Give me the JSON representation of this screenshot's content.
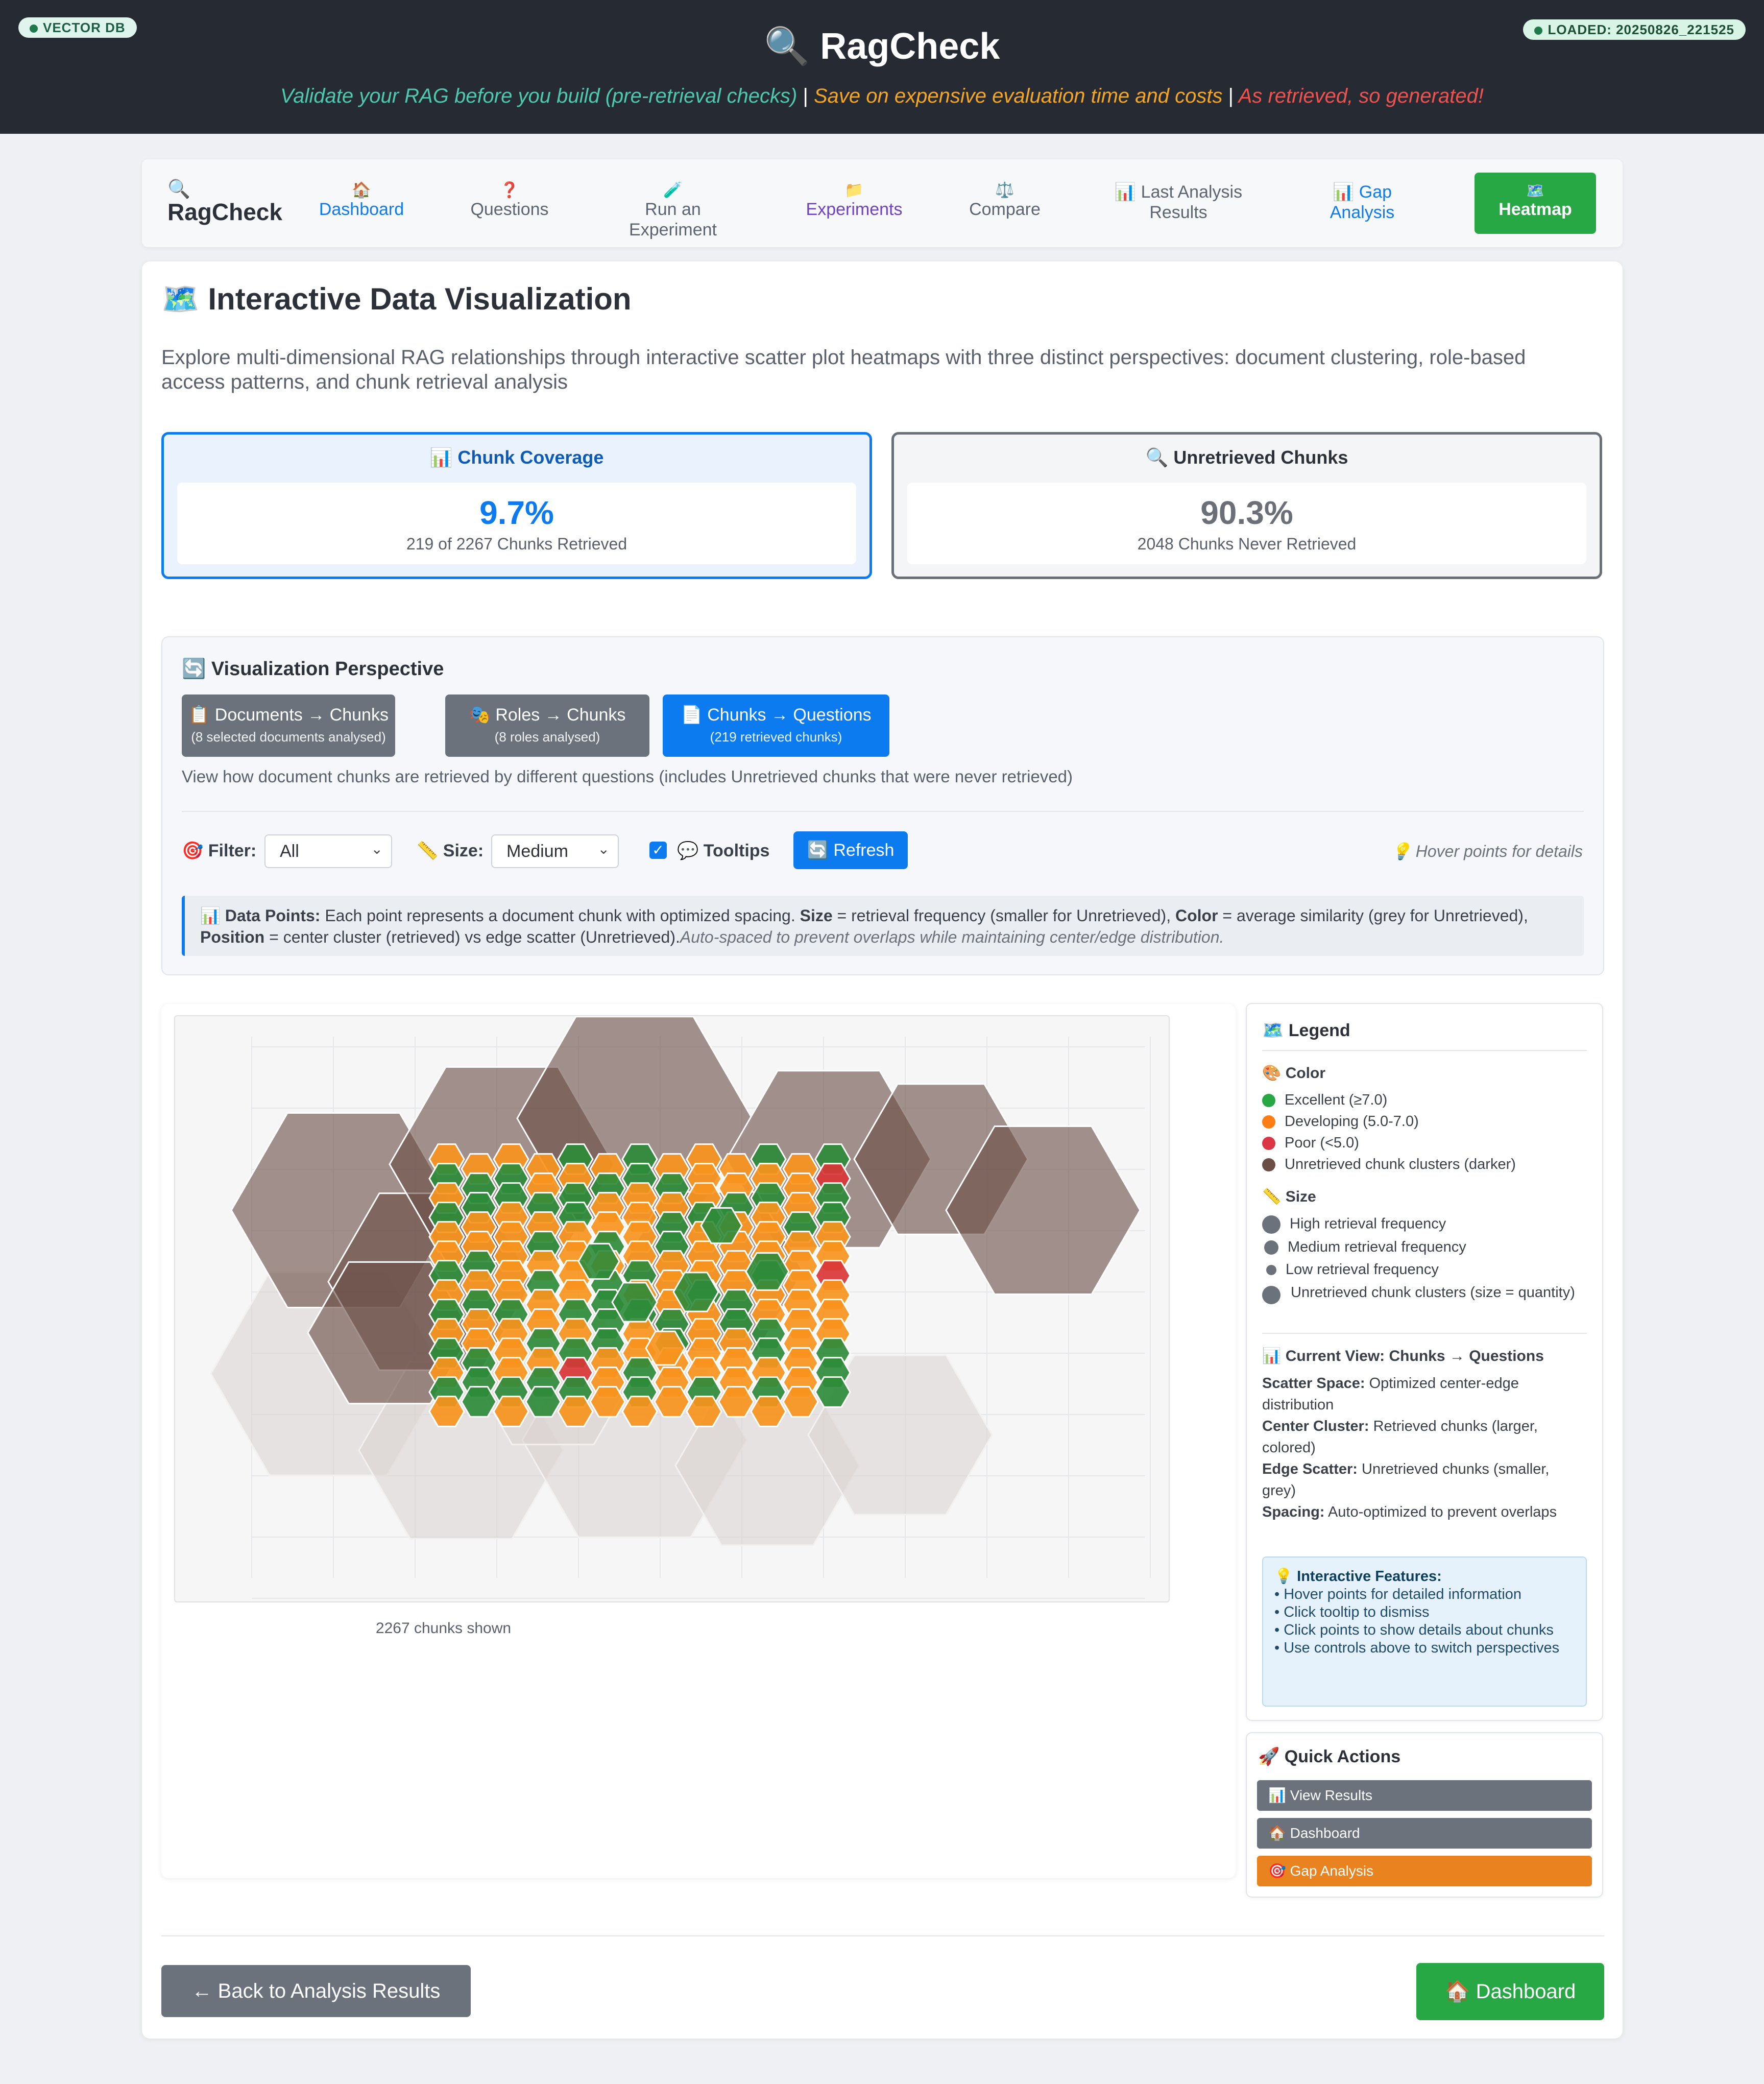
{
  "header": {
    "badge_left": "VECTOR DB",
    "badge_right": "LOADED: 20250826_221525",
    "title": "🔍 RagCheck",
    "tagline": {
      "part1": "Validate your RAG before you build (pre-retrieval checks)",
      "part2": "Save on expensive evaluation time and costs",
      "part3": "As retrieved, so generated!",
      "separator": "|",
      "colors": {
        "part1": "#4ec9b0",
        "part2": "#f5a623",
        "part3": "#ef5350"
      }
    }
  },
  "nav": {
    "brand_icon": "🔍",
    "brand": "RagCheck",
    "items": [
      {
        "icon": "🏠",
        "line1": "Dashboard",
        "line2": "",
        "color": "#0d7bf0"
      },
      {
        "icon": "❓",
        "line1": "Questions",
        "line2": "",
        "color": "#5c6470"
      },
      {
        "icon": "🧪",
        "line1": "Run an",
        "line2": "Experiment",
        "color": "#5c6470"
      },
      {
        "icon": "📁",
        "line1": "Experiments",
        "line2": "",
        "color": "#6f42c1"
      },
      {
        "icon": "⚖️",
        "line1": "Compare",
        "line2": "",
        "color": "#5c6470"
      },
      {
        "icon": "📊",
        "line1": "Last Analysis",
        "line2": "Results",
        "color": "#5c6470"
      },
      {
        "icon": "📊",
        "line1": "Gap",
        "line2": "Analysis",
        "color": "#0d7bf0"
      }
    ],
    "active": {
      "icon": "🗺️",
      "label": "Heatmap"
    }
  },
  "page": {
    "title": "🗺️ Interactive Data Visualization",
    "intro": "Explore multi-dimensional RAG relationships through interactive scatter plot heatmaps with three distinct perspectives: document clustering, role-based access patterns, and chunk retrieval analysis"
  },
  "stats": {
    "coverage": {
      "title": "📊 Chunk Coverage",
      "value": "9.7%",
      "sub": "219 of 2267 Chunks Retrieved",
      "color": "#0d7bf0"
    },
    "unretrieved": {
      "title": "🔍 Unretrieved Chunks",
      "value": "90.3%",
      "sub": "2048 Chunks Never Retrieved",
      "color": "#6b7078"
    }
  },
  "perspective": {
    "title": "🔄 Visualization Perspective",
    "buttons": [
      {
        "label": "📋 Documents → Chunks",
        "sub": "(8 selected documents analysed)",
        "active": false
      },
      {
        "label": "🎭 Roles → Chunks",
        "sub": "(8 roles analysed)",
        "active": false
      },
      {
        "label": "📄 Chunks → Questions",
        "sub": "(219 retrieved chunks)",
        "active": true
      }
    ],
    "description": "View how document chunks are retrieved by different questions (includes Unretrieved chunks that were never retrieved)",
    "filter_label": "🎯 Filter:",
    "filter_value": "All",
    "size_label": "📏 Size:",
    "size_value": "Medium",
    "tooltips_label": "💬 Tooltips",
    "tooltips_checked": true,
    "refresh_label": "🔄 Refresh",
    "hint": "💡 Hover points for details",
    "info": {
      "lead": "📊 Data Points:",
      "t1": " Each point represents a document chunk with optimized spacing. ",
      "b1": "Size",
      "t2": " = retrieval frequency (smaller for Unretrieved), ",
      "b2": "Color",
      "t3": " = average similarity (grey for Unretrieved), ",
      "b3": "Position",
      "t4": " = center cluster (retrieved) vs edge scatter (Unretrieved).",
      "i1": "Auto-spaced to prevent overlaps while maintaining center/edge distribution."
    }
  },
  "plot": {
    "caption": "2267 chunks shown",
    "colors": {
      "excellent": "#2e8b3a",
      "developing": "#f7941d",
      "poor": "#d93636",
      "unretrieved": "#6b4f47"
    }
  },
  "legend": {
    "title": "🗺️ Legend",
    "color_title": "🎨 Color",
    "color_items": [
      {
        "label": "Excellent (≥7.0)",
        "color": "#28a745"
      },
      {
        "label": "Developing (5.0-7.0)",
        "color": "#fd7e14"
      },
      {
        "label": "Poor (<5.0)",
        "color": "#dc3545"
      },
      {
        "label": "Unretrieved chunk clusters (darker)",
        "color": "#6b4f47"
      }
    ],
    "size_title": "📏 Size",
    "size_items": [
      {
        "label": "High retrieval frequency"
      },
      {
        "label": "Medium retrieval frequency"
      },
      {
        "label": "Low retrieval frequency"
      },
      {
        "label": "Unretrieved chunk clusters (size = quantity)"
      }
    ],
    "view_title": "📊 Current View: Chunks → Questions",
    "view_items": [
      {
        "key": "Scatter Space:",
        "value": "Optimized center-edge distribution"
      },
      {
        "key": "Center Cluster:",
        "value": "Retrieved chunks (larger, colored)"
      },
      {
        "key": "Edge Scatter:",
        "value": "Unretrieved chunks (smaller, grey)"
      },
      {
        "key": "Spacing:",
        "value": "Auto-optimized to prevent overlaps"
      }
    ],
    "features_title": "💡 Interactive Features:",
    "features": [
      "• Hover points for detailed information",
      "• Click tooltip to dismiss",
      "• Click points to show details about chunks",
      "• Use controls above to switch perspectives"
    ]
  },
  "quick_actions": {
    "title": "🚀 Quick Actions",
    "buttons": [
      {
        "label": "📊 View Results",
        "color": "#6c727b"
      },
      {
        "label": "🏠 Dashboard",
        "color": "#6c727b"
      },
      {
        "label": "🎯 Gap Analysis",
        "color": "#e8831f"
      }
    ]
  },
  "footer": {
    "back_label": "← Back to Analysis Results",
    "dashboard_label": "🏠 Dashboard"
  }
}
